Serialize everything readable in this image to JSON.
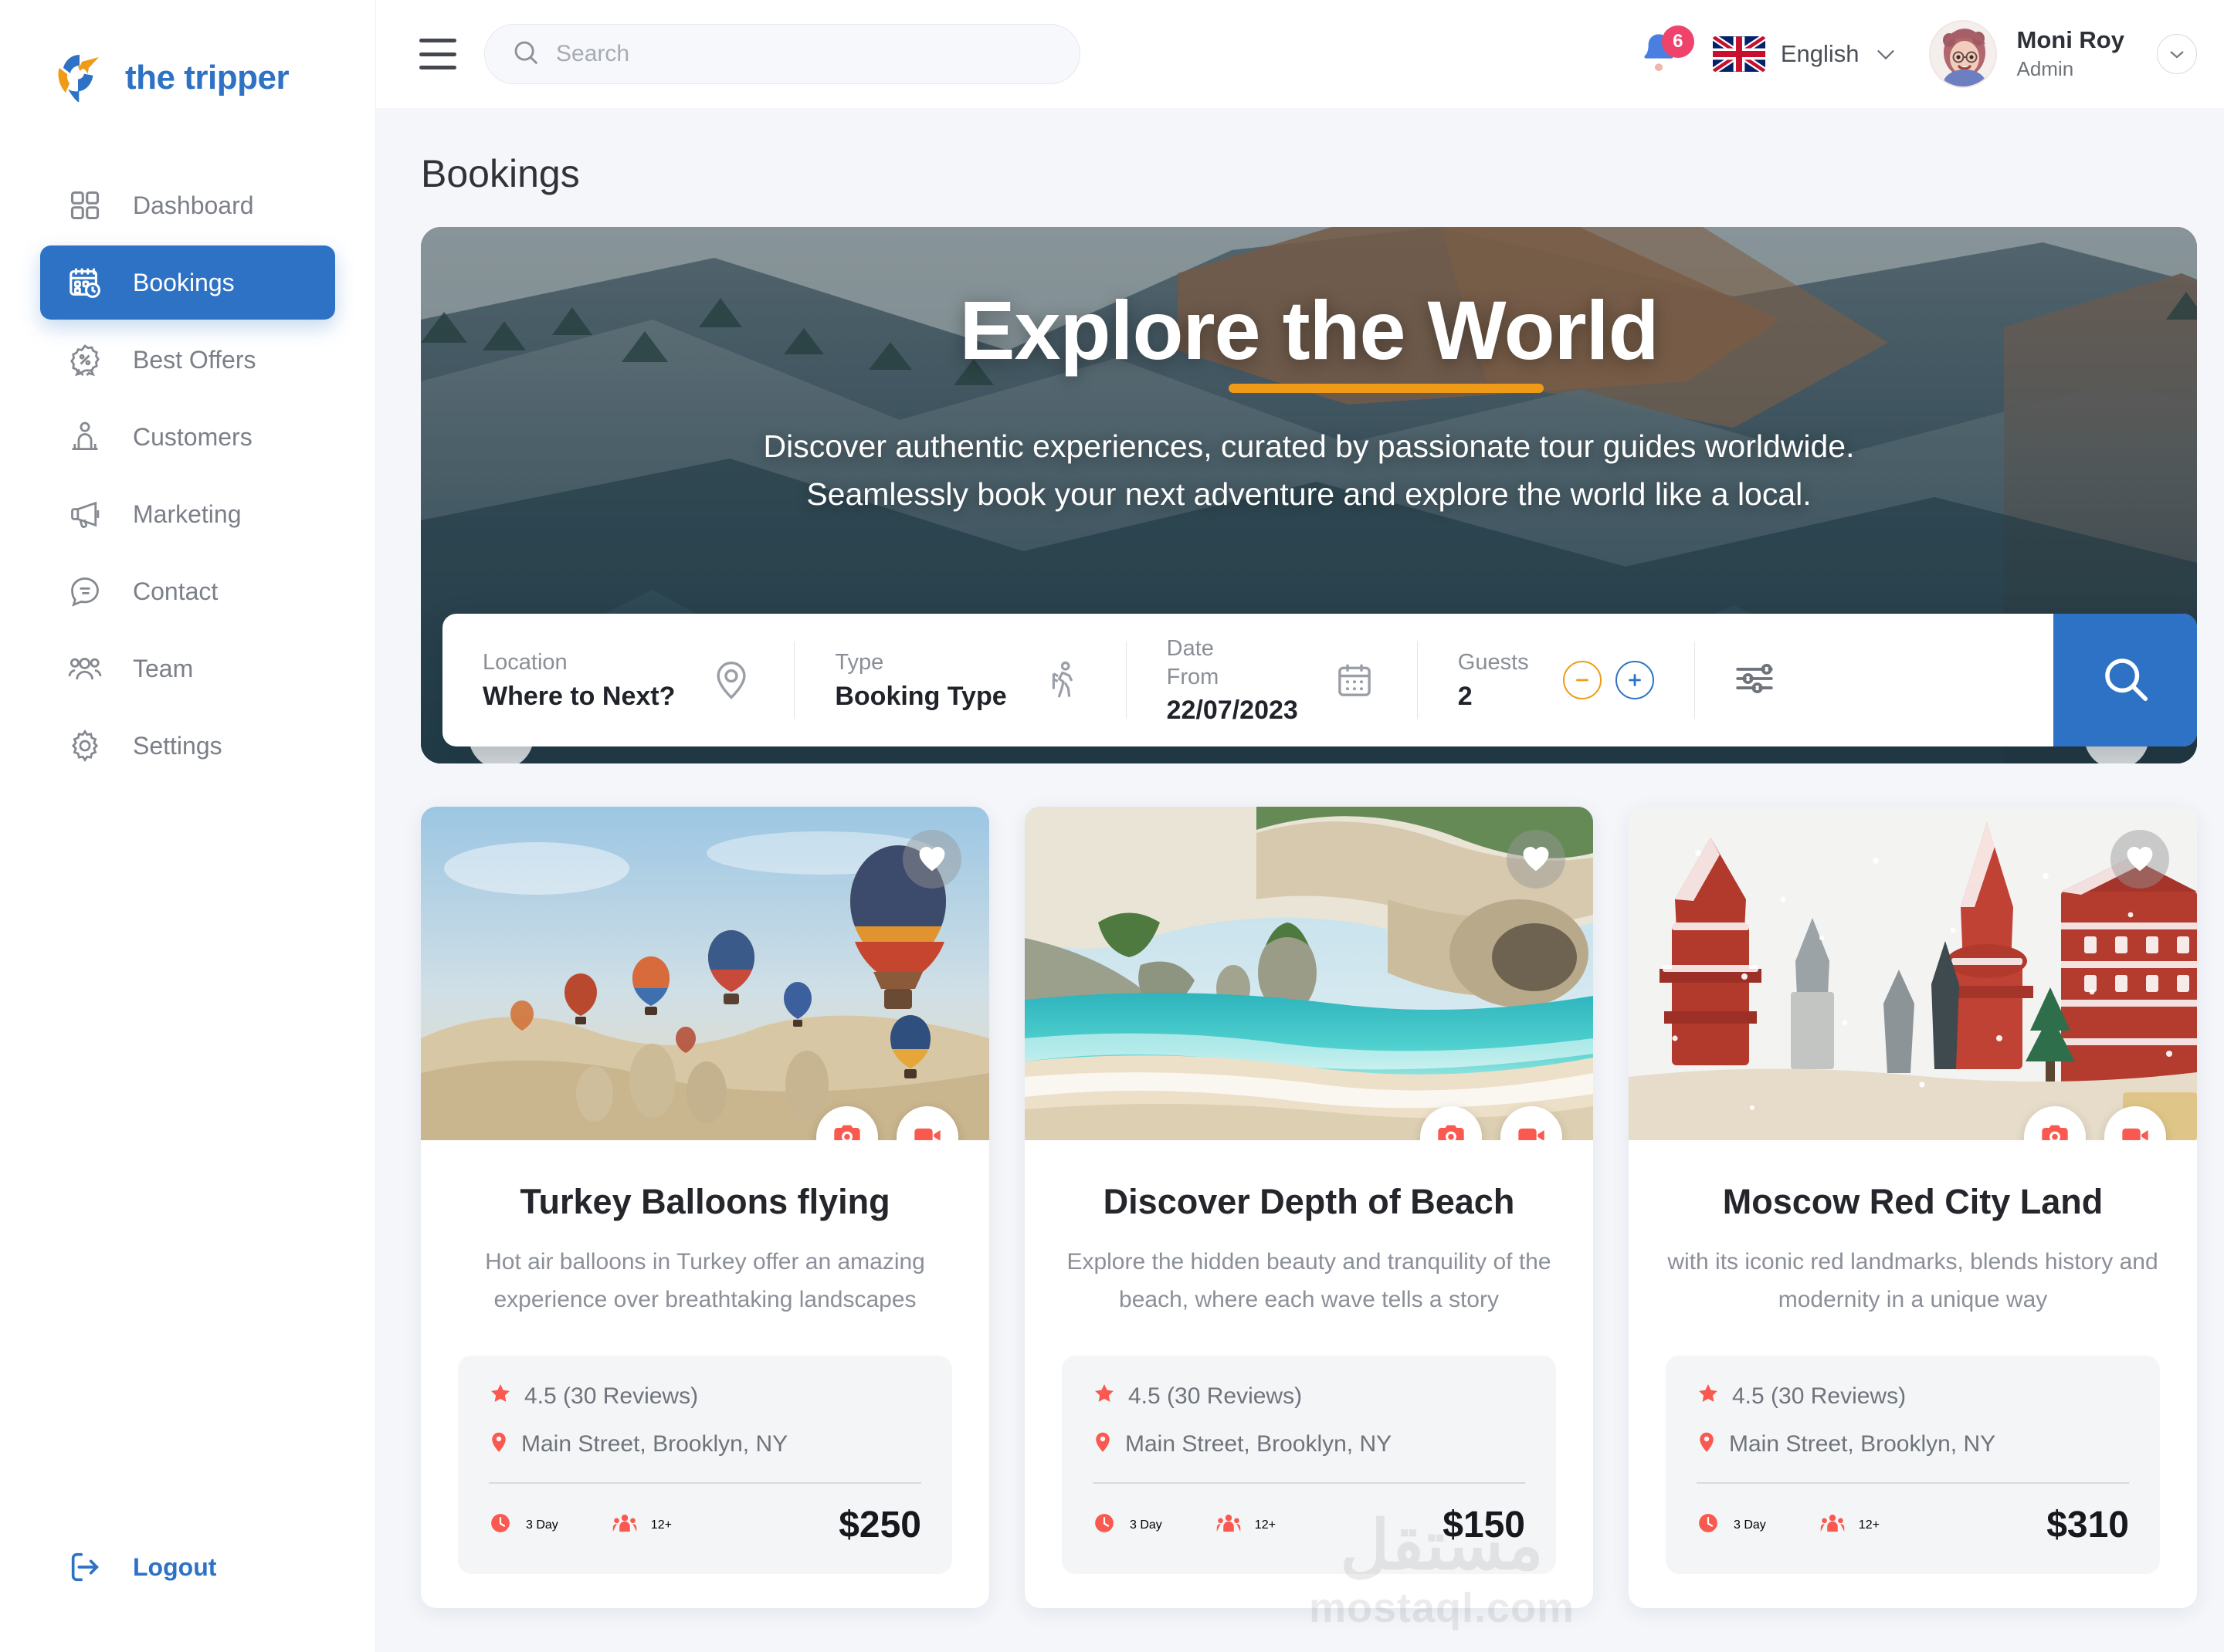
{
  "brand": {
    "name": "the tripper",
    "logo_icon": "location-pin-plane-icon",
    "accent": "#2d72c4",
    "accent_orange": "#ef9b18"
  },
  "sidebar": {
    "items": [
      {
        "label": "Dashboard",
        "icon": "grid-icon",
        "active": false
      },
      {
        "label": "Bookings",
        "icon": "calendar-clock-icon",
        "active": true
      },
      {
        "label": "Best Offers",
        "icon": "badge-percent-icon",
        "active": false
      },
      {
        "label": "Customers",
        "icon": "user-group-icon",
        "active": false
      },
      {
        "label": "Marketing",
        "icon": "megaphone-icon",
        "active": false
      },
      {
        "label": "Contact",
        "icon": "chat-bubble-icon",
        "active": false
      },
      {
        "label": "Team",
        "icon": "people-icon",
        "active": false
      },
      {
        "label": "Settings",
        "icon": "gear-icon",
        "active": false
      }
    ],
    "logout": {
      "label": "Logout",
      "icon": "logout-arrow-icon"
    }
  },
  "topbar": {
    "menu_icon": "hamburger-icon",
    "search": {
      "placeholder": "Search",
      "value": "",
      "icon": "search-icon"
    },
    "notifications": {
      "icon": "bell-icon",
      "count": "6",
      "badge_color": "#f0436b"
    },
    "language": {
      "label": "English",
      "flag": "uk-flag-icon",
      "chevron": "chevron-down-icon"
    },
    "user": {
      "name": "Moni Roy",
      "role": "Admin",
      "avatar": "user-avatar",
      "chevron": "chevron-down-icon"
    }
  },
  "page": {
    "title": "Bookings"
  },
  "hero": {
    "title": "Explore the World",
    "subtitle_line1": "Discover authentic experiences, curated by passionate tour guides worldwide.",
    "subtitle_line2": "Seamlessly book your next adventure and explore the world like a local.",
    "prev_icon": "chevron-left-icon",
    "next_icon": "chevron-right-icon"
  },
  "search_panel": {
    "fields": [
      {
        "label": "Location",
        "value": "Where to Next?",
        "icon": "map-pin-icon"
      },
      {
        "label": "Type",
        "value": "Booking Type",
        "icon": "hiker-icon"
      },
      {
        "label": "Date",
        "sublabel": "From",
        "value": "22/07/2023",
        "icon": "calendar-icon"
      },
      {
        "label": "Guests",
        "value": "2",
        "icon": "stepper"
      }
    ],
    "stepper": {
      "minus": "minus-circle-icon",
      "plus": "plus-circle-icon",
      "minus_color": "#ef9b18",
      "plus_color": "#2d72c4"
    },
    "filter_icon": "sliders-icon",
    "search_button_icon": "search-icon",
    "search_button_color": "#2d72c4"
  },
  "cards": [
    {
      "title": "Turkey Balloons flying",
      "description": "Hot air balloons in Turkey offer an amazing experience over breathtaking landscapes",
      "rating": "4.5 (30 Reviews)",
      "location": "Main Street, Brooklyn, NY",
      "duration": "3 Day",
      "age": "12+",
      "price": "$250",
      "image": "hot-air-balloons-cappadocia",
      "favorite_icon": "heart-icon",
      "photo_icon": "camera-icon",
      "video_icon": "video-icon"
    },
    {
      "title": "Discover Depth of Beach",
      "description": "Explore the hidden beauty and tranquility of the beach, where each wave tells a story",
      "rating": "4.5 (30 Reviews)",
      "location": "Main Street, Brooklyn, NY",
      "duration": "3 Day",
      "age": "12+",
      "price": "$150",
      "image": "tropical-beach-cove",
      "favorite_icon": "heart-icon",
      "photo_icon": "camera-icon",
      "video_icon": "video-icon"
    },
    {
      "title": "Moscow Red City Land",
      "description": "with its iconic red landmarks, blends history and modernity in a unique way",
      "rating": "4.5 (30 Reviews)",
      "location": "Main Street, Brooklyn, NY",
      "duration": "3 Day",
      "age": "12+",
      "price": "$310",
      "image": "moscow-red-square-snow",
      "favorite_icon": "heart-icon",
      "photo_icon": "camera-icon",
      "video_icon": "video-icon"
    }
  ],
  "watermark": {
    "arabic": "مستقل",
    "latin": "mostaql.com"
  }
}
